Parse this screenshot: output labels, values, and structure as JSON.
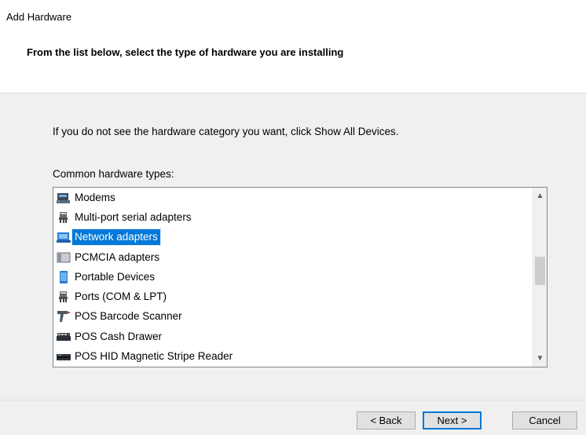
{
  "window": {
    "title": "Add Hardware"
  },
  "header": {
    "heading": "From the list below, select the type of hardware you are installing"
  },
  "main": {
    "instruction": "If you do not see the hardware category you want, click Show All Devices.",
    "list_label": "Common hardware types:",
    "items": [
      {
        "label": "Modems",
        "icon": "modem-icon",
        "selected": false
      },
      {
        "label": "Multi-port serial adapters",
        "icon": "serial-port-icon",
        "selected": false
      },
      {
        "label": "Network adapters",
        "icon": "network-adapter-icon",
        "selected": true
      },
      {
        "label": "PCMCIA adapters",
        "icon": "pcmcia-card-icon",
        "selected": false
      },
      {
        "label": "Portable Devices",
        "icon": "portable-device-icon",
        "selected": false
      },
      {
        "label": "Ports (COM & LPT)",
        "icon": "port-connector-icon",
        "selected": false
      },
      {
        "label": "POS Barcode Scanner",
        "icon": "barcode-scanner-icon",
        "selected": false
      },
      {
        "label": "POS Cash Drawer",
        "icon": "cash-drawer-icon",
        "selected": false
      },
      {
        "label": "POS HID Magnetic Stripe Reader",
        "icon": "magnetic-stripe-reader-icon",
        "selected": false
      }
    ]
  },
  "footer": {
    "back_label": "< Back",
    "next_label": "Next >",
    "cancel_label": "Cancel"
  },
  "colors": {
    "selection": "#0078d7",
    "focus_border": "#0078d7"
  }
}
